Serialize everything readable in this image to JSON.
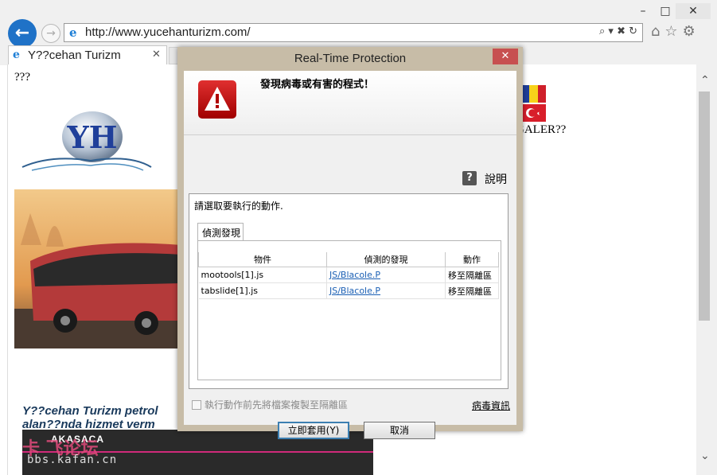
{
  "window": {
    "minimize": "–",
    "maximize": "□",
    "close": "✕"
  },
  "browser": {
    "url": "http://www.yucehanturizm.com/",
    "address_icons": "⌕ ▾ ✖ ↻",
    "nav_icons": "⌂☆⚙",
    "tab_title": "Y??cehan Turizm",
    "tab_close": "✕"
  },
  "page": {
    "top_text": "???",
    "logo_text": "YH",
    "right_text": "GALER??",
    "promo_text": "Y??cehan Turizm petrol alan??nda hizmet verm",
    "strip_title": "AKASACA"
  },
  "watermark": {
    "line1": "卡 飞论坛",
    "line2": "bbs.kafan.cn"
  },
  "dialog": {
    "title": "Real-Time Protection",
    "heading": "發現病毒或有害的程式！",
    "help_icon": "?",
    "help_label": "說明",
    "group_label": "請選取要執行的動作.",
    "tab_label": "偵測發現",
    "columns": [
      "物件",
      "偵測的發現",
      "動作"
    ],
    "rows": [
      {
        "object": "mootools[1].js",
        "finding": "JS/Blacole.P",
        "action": "移至隔離區"
      },
      {
        "object": "tabslide[1].js",
        "finding": "JS/Blacole.P",
        "action": "移至隔離區"
      }
    ],
    "checkbox_label": "執行動作前先將檔案複製至隔離區",
    "checkbox_checked": false,
    "virus_info_link": "病毒資訊",
    "apply_button": "立即套用(Y)",
    "cancel_button": "取消",
    "close": "✕"
  },
  "scrollbar": {
    "up": "ⱏ",
    "down": "ⱅ"
  }
}
